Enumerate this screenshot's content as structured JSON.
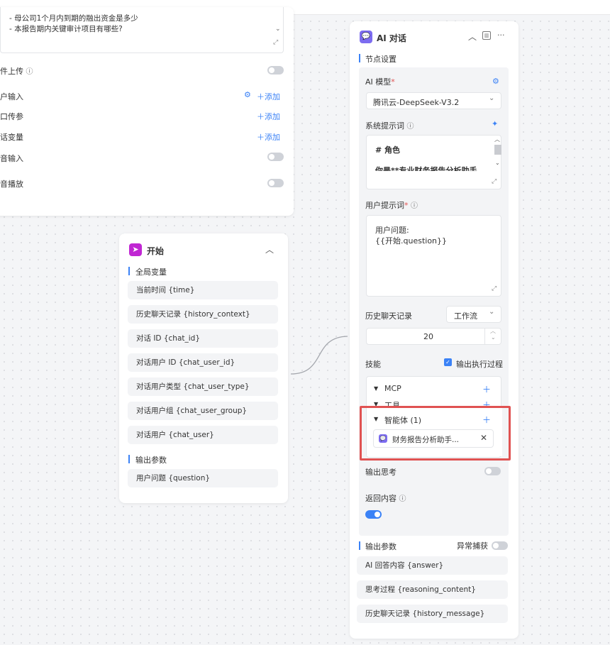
{
  "left_panel": {
    "textarea_lines": [
      "-  母公司1个月内到期的融出资金是多少",
      "-  本报告期内关键审计项目有哪些?"
    ],
    "rows": [
      {
        "label": "件上传",
        "has_info": true,
        "control": "toggle"
      },
      {
        "label": "户输入",
        "control": "add",
        "gear": true
      },
      {
        "label": "口传参",
        "control": "add"
      },
      {
        "label": "话变量",
        "control": "add"
      },
      {
        "label": "音输入",
        "control": "toggle"
      },
      {
        "label": "音播放",
        "control": "toggle"
      }
    ],
    "add_label": "添加",
    "info_glyph": "ⓘ"
  },
  "start_node": {
    "title": "开始",
    "section_global": "全局变量",
    "global_vars": [
      "当前时间 {time}",
      "历史聊天记录 {history_context}",
      "对话 ID {chat_id}",
      "对话用户 ID {chat_user_id}",
      "对话用户类型 {chat_user_type}",
      "对话用户组 {chat_user_group}",
      "对话用户 {chat_user}"
    ],
    "section_output": "输出参数",
    "output_vars": [
      "用户问题 {question}"
    ]
  },
  "ai_node": {
    "title": "AI 对话",
    "node_settings": "节点设置",
    "model_label": "AI 模型",
    "model_value": "腾讯云-DeepSeek-V3.2",
    "system_prompt_label": "系统提示词",
    "system_prompt_line1": "#  角色",
    "system_prompt_line2": "你是**专业财务报告分析助手",
    "user_prompt_label": "用户提示词",
    "user_prompt_line1": "用户问题:",
    "user_prompt_line2": "{{开始.question}}",
    "history_label": "历史聊天记录",
    "history_mode": "工作流",
    "history_count": "20",
    "skills_label": "技能",
    "show_process_label": "输出执行过程",
    "skills": [
      {
        "label": "MCP"
      },
      {
        "label": "工具"
      },
      {
        "label": "智能体 (1)"
      }
    ],
    "agent_item": "财务报告分析助手...",
    "output_thinking_label": "输出思考",
    "return_content_label": "返回内容",
    "output_params_label": "输出参数",
    "exception_label": "异常捕获",
    "outputs": [
      "AI 回答内容 {answer}",
      "思考过程 {reasoning_content}",
      "历史聊天记录 {history_message}"
    ],
    "more_glyph": "···"
  },
  "colors": {
    "accent": "#3b82f6",
    "highlight": "#e05252",
    "start_icon": "#c026d3",
    "ai_icon": "#7c6cf0"
  }
}
